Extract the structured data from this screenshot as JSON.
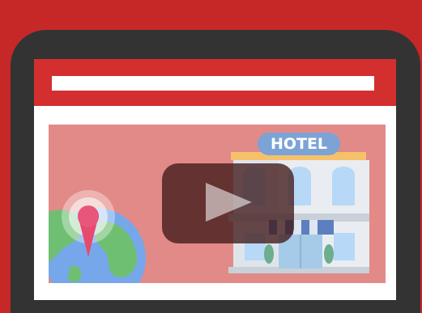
{
  "hero": {
    "hotel_sign": "HOTEL",
    "play_icon": "play-icon",
    "pin_icon": "map-pin-icon",
    "globe_icon": "globe-icon",
    "hotel_icon": "hotel-building-icon"
  },
  "colors": {
    "background": "#c62828",
    "device": "#333333",
    "browser_bar": "#d32f2f",
    "hero_bg": "#e28a88",
    "sign": "#7ca3d6"
  }
}
